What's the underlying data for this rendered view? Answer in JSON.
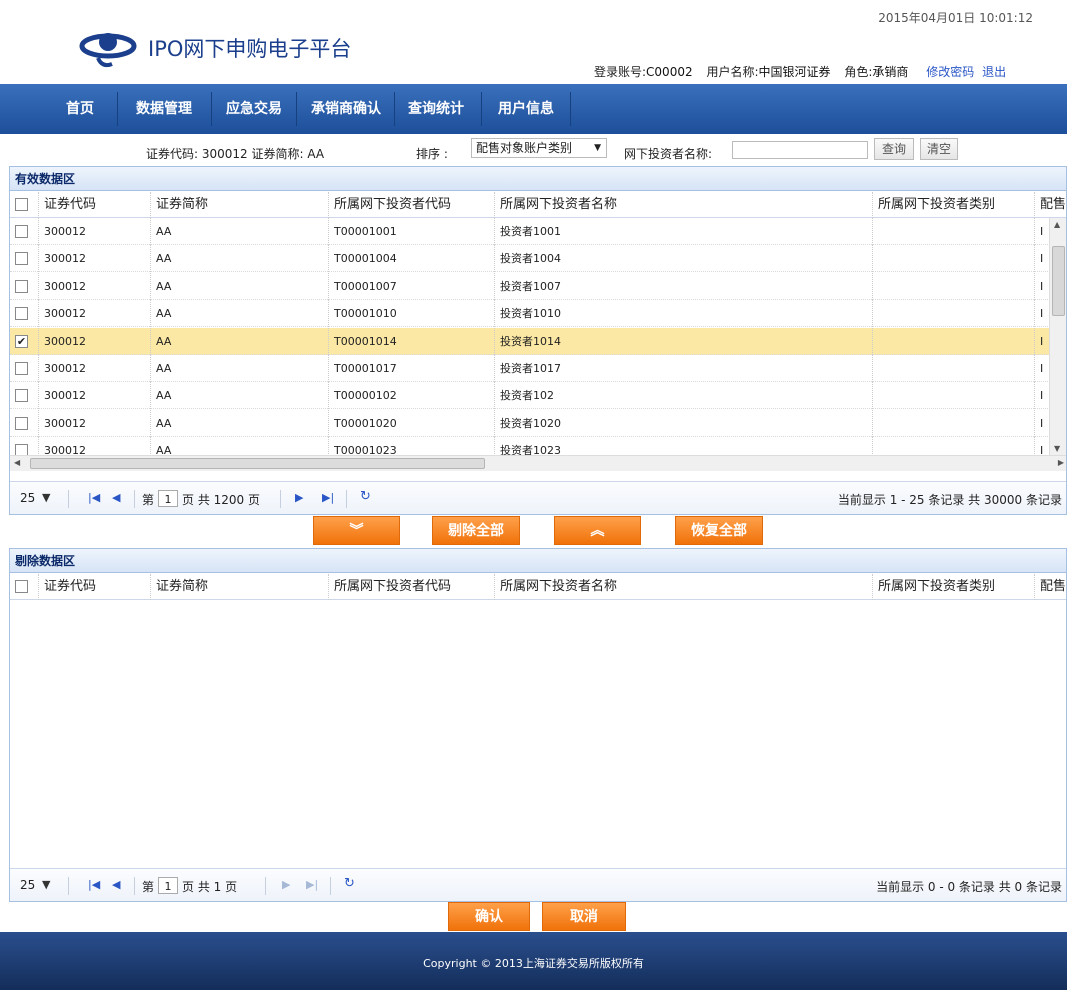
{
  "header": {
    "app_title": "IPO网下申购电子平台",
    "datetime": "2015年04月01日 10:01:12",
    "user": {
      "account_label": "登录账号:",
      "account_value": "C00002",
      "name_label": "用户名称:",
      "name_value": "中国银河证券",
      "role_label": "角色:",
      "role_value": "承销商",
      "change_password": "修改密码",
      "logout": "退出"
    }
  },
  "nav": {
    "items": [
      {
        "label": "首页"
      },
      {
        "label": "数据管理"
      },
      {
        "label": "应急交易"
      },
      {
        "label": "承销商确认"
      },
      {
        "label": "查询统计"
      },
      {
        "label": "用户信息"
      }
    ],
    "accent": "#1d4f9a"
  },
  "filter": {
    "security_info": "证券代码: 300012 证券简称: AA",
    "sort_label": "排序 :",
    "sort_value": "配售对象账户类别",
    "investor_label": "网下投资者名称:",
    "investor_value": "",
    "query_button": "查询",
    "clear_button": "清空"
  },
  "valid_panel": {
    "title": "有效数据区",
    "columns": [
      "证券代码",
      "证券简称",
      "所属网下投资者代码",
      "所属网下投资者名称",
      "所属网下投资者类别",
      "配售"
    ],
    "rows": [
      {
        "code": "300012",
        "abbr": "AA",
        "inv_code": "T00001001",
        "inv_name": "投资者1001",
        "category": "",
        "extra": "I",
        "checked": false
      },
      {
        "code": "300012",
        "abbr": "AA",
        "inv_code": "T00001004",
        "inv_name": "投资者1004",
        "category": "",
        "extra": "I",
        "checked": false
      },
      {
        "code": "300012",
        "abbr": "AA",
        "inv_code": "T00001007",
        "inv_name": "投资者1007",
        "category": "",
        "extra": "I",
        "checked": false
      },
      {
        "code": "300012",
        "abbr": "AA",
        "inv_code": "T00001010",
        "inv_name": "投资者1010",
        "category": "",
        "extra": "I",
        "checked": false
      },
      {
        "code": "300012",
        "abbr": "AA",
        "inv_code": "T00001014",
        "inv_name": "投资者1014",
        "category": "",
        "extra": "I",
        "checked": true
      },
      {
        "code": "300012",
        "abbr": "AA",
        "inv_code": "T00001017",
        "inv_name": "投资者1017",
        "category": "",
        "extra": "I",
        "checked": false
      },
      {
        "code": "300012",
        "abbr": "AA",
        "inv_code": "T00000102",
        "inv_name": "投资者102",
        "category": "",
        "extra": "I",
        "checked": false
      },
      {
        "code": "300012",
        "abbr": "AA",
        "inv_code": "T00001020",
        "inv_name": "投资者1020",
        "category": "",
        "extra": "I",
        "checked": false
      },
      {
        "code": "300012",
        "abbr": "AA",
        "inv_code": "T00001023",
        "inv_name": "投资者1023",
        "category": "",
        "extra": "I",
        "checked": false
      }
    ],
    "pager": {
      "page_size": "25",
      "page_prefix": "第",
      "page_value": "1",
      "page_suffix": "页 共 1200 页",
      "summary": "当前显示 1 - 25 条记录 共 30000 条记录"
    }
  },
  "transfer": {
    "move_down": "︾",
    "remove_all": "剔除全部",
    "move_up": "︽",
    "restore_all": "恢复全部"
  },
  "removed_panel": {
    "title": "剔除数据区",
    "columns": [
      "证券代码",
      "证券简称",
      "所属网下投资者代码",
      "所属网下投资者名称",
      "所属网下投资者类别",
      "配售"
    ],
    "pager": {
      "page_size": "25",
      "page_prefix": "第",
      "page_value": "1",
      "page_suffix": "页 共 1 页",
      "summary": "当前显示 0 - 0 条记录 共 0 条记录"
    }
  },
  "actions": {
    "confirm": "确认",
    "cancel": "取消"
  },
  "footer": {
    "copyright": "Copyright © 2013上海证券交易所版权所有"
  }
}
